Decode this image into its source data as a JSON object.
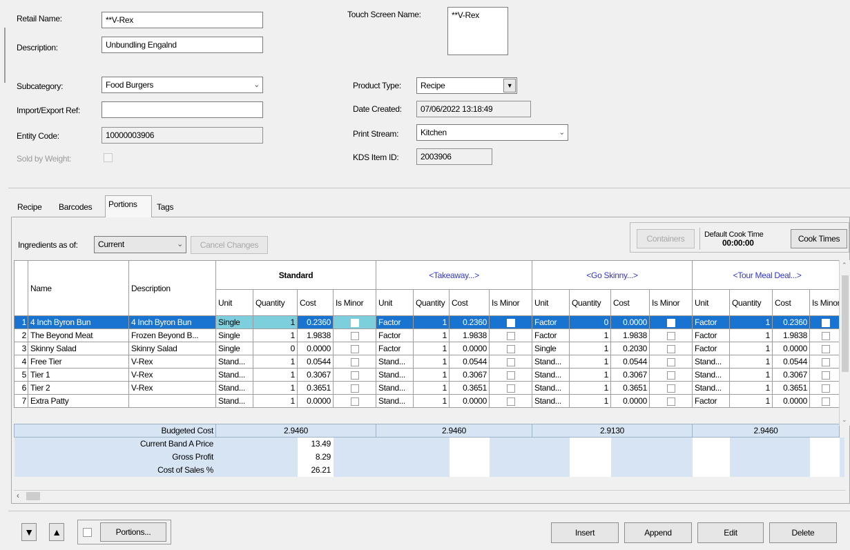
{
  "header": {
    "retail_name_label": "Retail Name:",
    "retail_name_value": "**V-Rex",
    "description_label": "Description:",
    "description_value": "Unbundling Engalnd",
    "touch_screen_label": "Touch Screen Name:",
    "touch_screen_value": "**V-Rex",
    "subcategory_label": "Subcategory:",
    "subcategory_value": "Food Burgers",
    "import_export_label": "Import/Export Ref:",
    "import_export_value": "",
    "entity_code_label": "Entity Code:",
    "entity_code_value": "10000003906",
    "sold_by_weight_label": "Sold by Weight:",
    "product_type_label": "Product Type:",
    "product_type_value": "Recipe",
    "date_created_label": "Date Created:",
    "date_created_value": "07/06/2022 13:18:49",
    "print_stream_label": "Print Stream:",
    "print_stream_value": "Kitchen",
    "kds_label": "KDS Item ID:",
    "kds_value": "2003906"
  },
  "tabs": [
    "Recipe",
    "Barcodes",
    "Portions",
    "Tags"
  ],
  "active_tab": "Portions",
  "toolbar": {
    "ingredients_label": "Ingredients as of:",
    "ingredients_value": "Current",
    "cancel_changes": "Cancel Changes",
    "containers": "Containers",
    "default_cook_time_label": "Default Cook Time",
    "default_cook_time_value": "00:00:00",
    "cook_times": "Cook Times"
  },
  "grid": {
    "name_header": "Name",
    "description_header": "Description",
    "groups": [
      "Standard",
      "<Takeaway...>",
      "<Go Skinny...>",
      "<Tour Meal Deal...>"
    ],
    "subheaders": [
      "Unit",
      "Quantity",
      "Cost",
      "Is Minor"
    ],
    "rows": [
      {
        "n": "1",
        "name": "4 Inch Byron Bun",
        "desc": "4 Inch Byron Bun",
        "c": [
          [
            "Single",
            "1",
            "0.2360"
          ],
          [
            "Factor",
            "1",
            "0.2360"
          ],
          [
            "Factor",
            "0",
            "0.0000"
          ],
          [
            "Factor",
            "1",
            "0.2360"
          ]
        ]
      },
      {
        "n": "2",
        "name": "The Beyond Meat",
        "desc": "Frozen Beyond B...",
        "c": [
          [
            "Single",
            "1",
            "1.9838"
          ],
          [
            "Factor",
            "1",
            "1.9838"
          ],
          [
            "Factor",
            "1",
            "1.9838"
          ],
          [
            "Factor",
            "1",
            "1.9838"
          ]
        ]
      },
      {
        "n": "3",
        "name": "Skinny Salad",
        "desc": "Skinny Salad",
        "c": [
          [
            "Single",
            "0",
            "0.0000"
          ],
          [
            "Factor",
            "1",
            "0.0000"
          ],
          [
            "Single",
            "1",
            "0.2030"
          ],
          [
            "Factor",
            "1",
            "0.0000"
          ]
        ]
      },
      {
        "n": "4",
        "name": "Free Tier",
        "desc": "V-Rex",
        "c": [
          [
            "Stand...",
            "1",
            "0.0544"
          ],
          [
            "Stand...",
            "1",
            "0.0544"
          ],
          [
            "Stand...",
            "1",
            "0.0544"
          ],
          [
            "Stand...",
            "1",
            "0.0544"
          ]
        ]
      },
      {
        "n": "5",
        "name": "Tier 1",
        "desc": "V-Rex",
        "c": [
          [
            "Stand...",
            "1",
            "0.3067"
          ],
          [
            "Stand...",
            "1",
            "0.3067"
          ],
          [
            "Stand...",
            "1",
            "0.3067"
          ],
          [
            "Stand...",
            "1",
            "0.3067"
          ]
        ]
      },
      {
        "n": "6",
        "name": "Tier 2",
        "desc": "V-Rex",
        "c": [
          [
            "Stand...",
            "1",
            "0.3651"
          ],
          [
            "Stand...",
            "1",
            "0.3651"
          ],
          [
            "Stand...",
            "1",
            "0.3651"
          ],
          [
            "Stand...",
            "1",
            "0.3651"
          ]
        ]
      },
      {
        "n": "7",
        "name": "Extra Patty",
        "desc": "",
        "c": [
          [
            "Stand...",
            "1",
            "0.0000"
          ],
          [
            "Stand...",
            "1",
            "0.0000"
          ],
          [
            "Stand...",
            "1",
            "0.0000"
          ],
          [
            "Factor",
            "1",
            "0.0000"
          ]
        ]
      }
    ]
  },
  "summary": {
    "budgeted_cost_label": "Budgeted Cost",
    "budgeted_costs": [
      "2.9460",
      "2.9460",
      "2.9130",
      "2.9460"
    ],
    "current_band_label": "Current Band A Price",
    "current_band_value": "13.49",
    "gross_profit_label": "Gross Profit",
    "gross_profit_value": "8.29",
    "cost_of_sales_label": "Cost of Sales %",
    "cost_of_sales_value": "26.21"
  },
  "footer": {
    "down_arrow": "▼",
    "up_arrow": "▲",
    "portions_button": "Portions...",
    "insert": "Insert",
    "append": "Append",
    "edit": "Edit",
    "delete": "Delete"
  },
  "colors": {
    "selection": "#1874d0",
    "standard_selected": "#7ecfde",
    "group_link": "#2e34d4",
    "summary_band": "#d6e4f3"
  }
}
